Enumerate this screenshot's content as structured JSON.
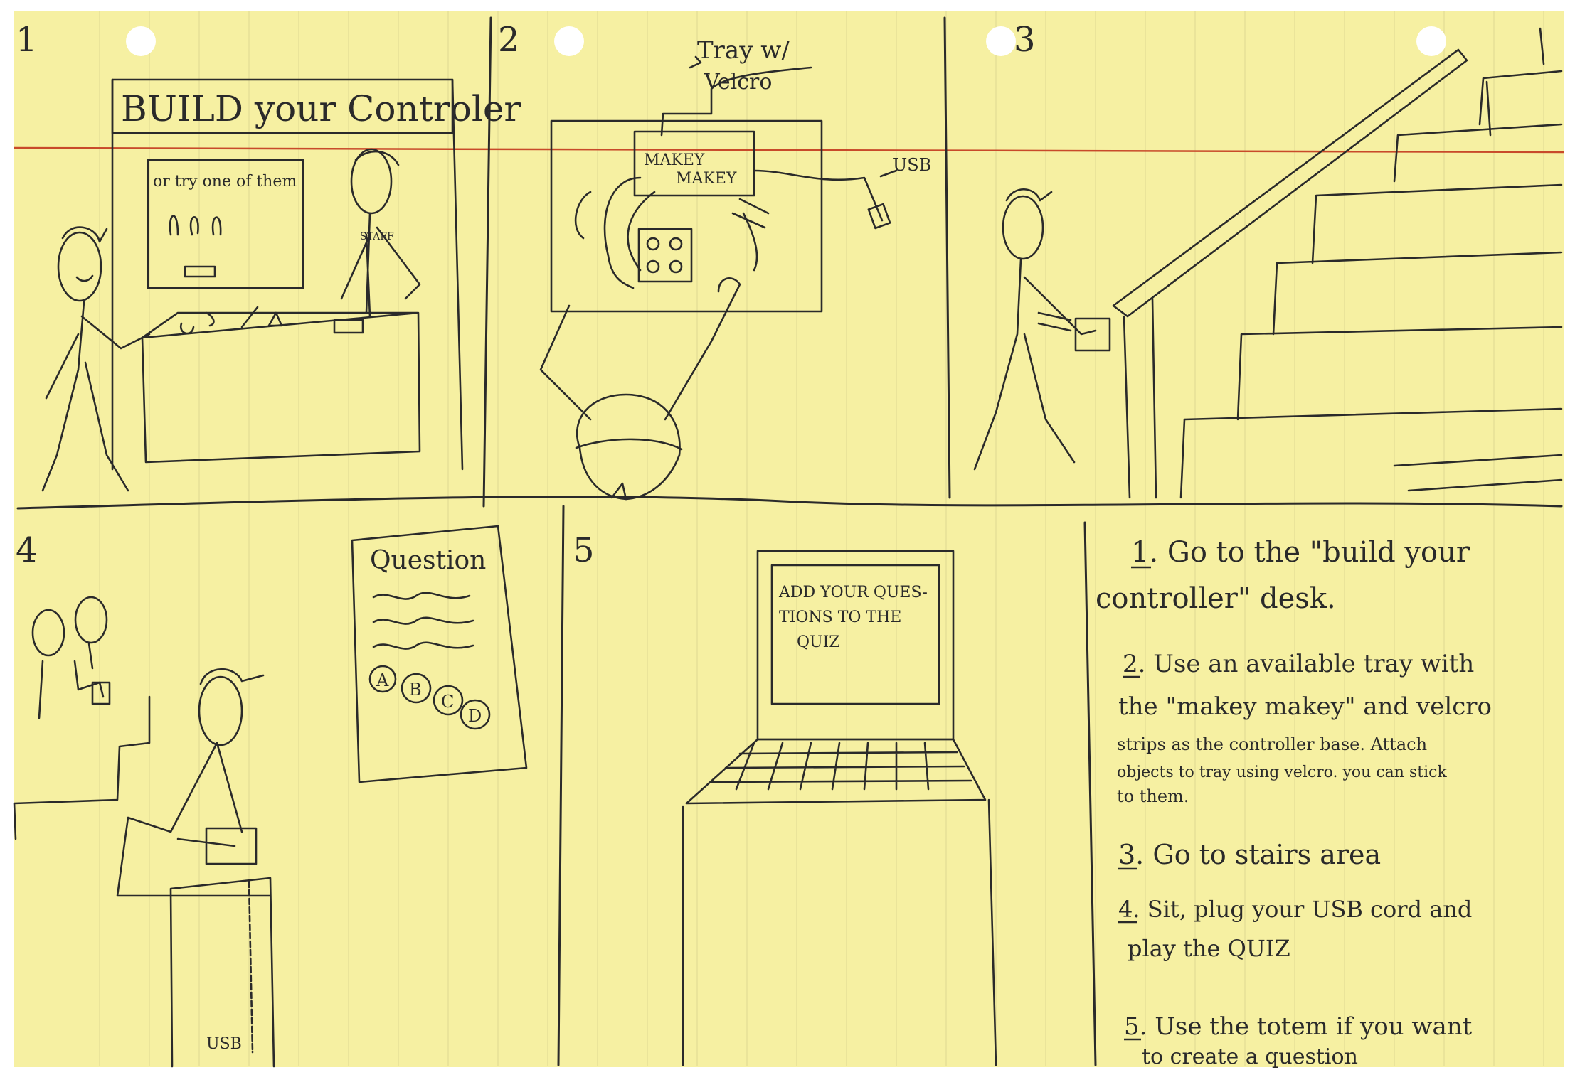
{
  "colors": {
    "paper": "#f6f0a2",
    "rule_line": "#c84a2a",
    "vertical_rules": "#e6df98",
    "ink": "#2a2a2a",
    "hole": "#ffffff"
  },
  "panels": [
    {
      "number": "1",
      "sign": "BUILD your Controler",
      "screen_text": "or try one of them",
      "shirt_text": "STAFF"
    },
    {
      "number": "2",
      "tray_label_line1": "Tray w/",
      "tray_label_line2": "Velcro",
      "board_line1": "MAKEY",
      "board_line2": "MAKEY",
      "usb_label": "USB"
    },
    {
      "number": "3"
    },
    {
      "number": "4",
      "card_title": "Question",
      "options": [
        "A",
        "B",
        "C",
        "D"
      ],
      "usb_label": "USB"
    },
    {
      "number": "5",
      "screen_line1": "ADD YOUR QUES-",
      "screen_line2": "TIONS TO THE",
      "screen_line3": "QUIZ"
    }
  ],
  "instructions": {
    "step1_line1": "1. Go to the \"build your",
    "step1_line2": "controller\" desk.",
    "step2_line1": "2. Use an available tray with",
    "step2_line2": "the \"makey makey\" and velcro",
    "step2_line3": "strips as the controller base. Attach",
    "step2_line4": "objects to tray using velcro. you can stick",
    "step2_line5": "to them.",
    "step3": "3. Go to stairs area",
    "step4_line1": "4. Sit, plug your USB cord and",
    "step4_line2": "play the QUIZ",
    "step5_line1": "5. Use the totem if you want",
    "step5_line2": "to create a question"
  }
}
